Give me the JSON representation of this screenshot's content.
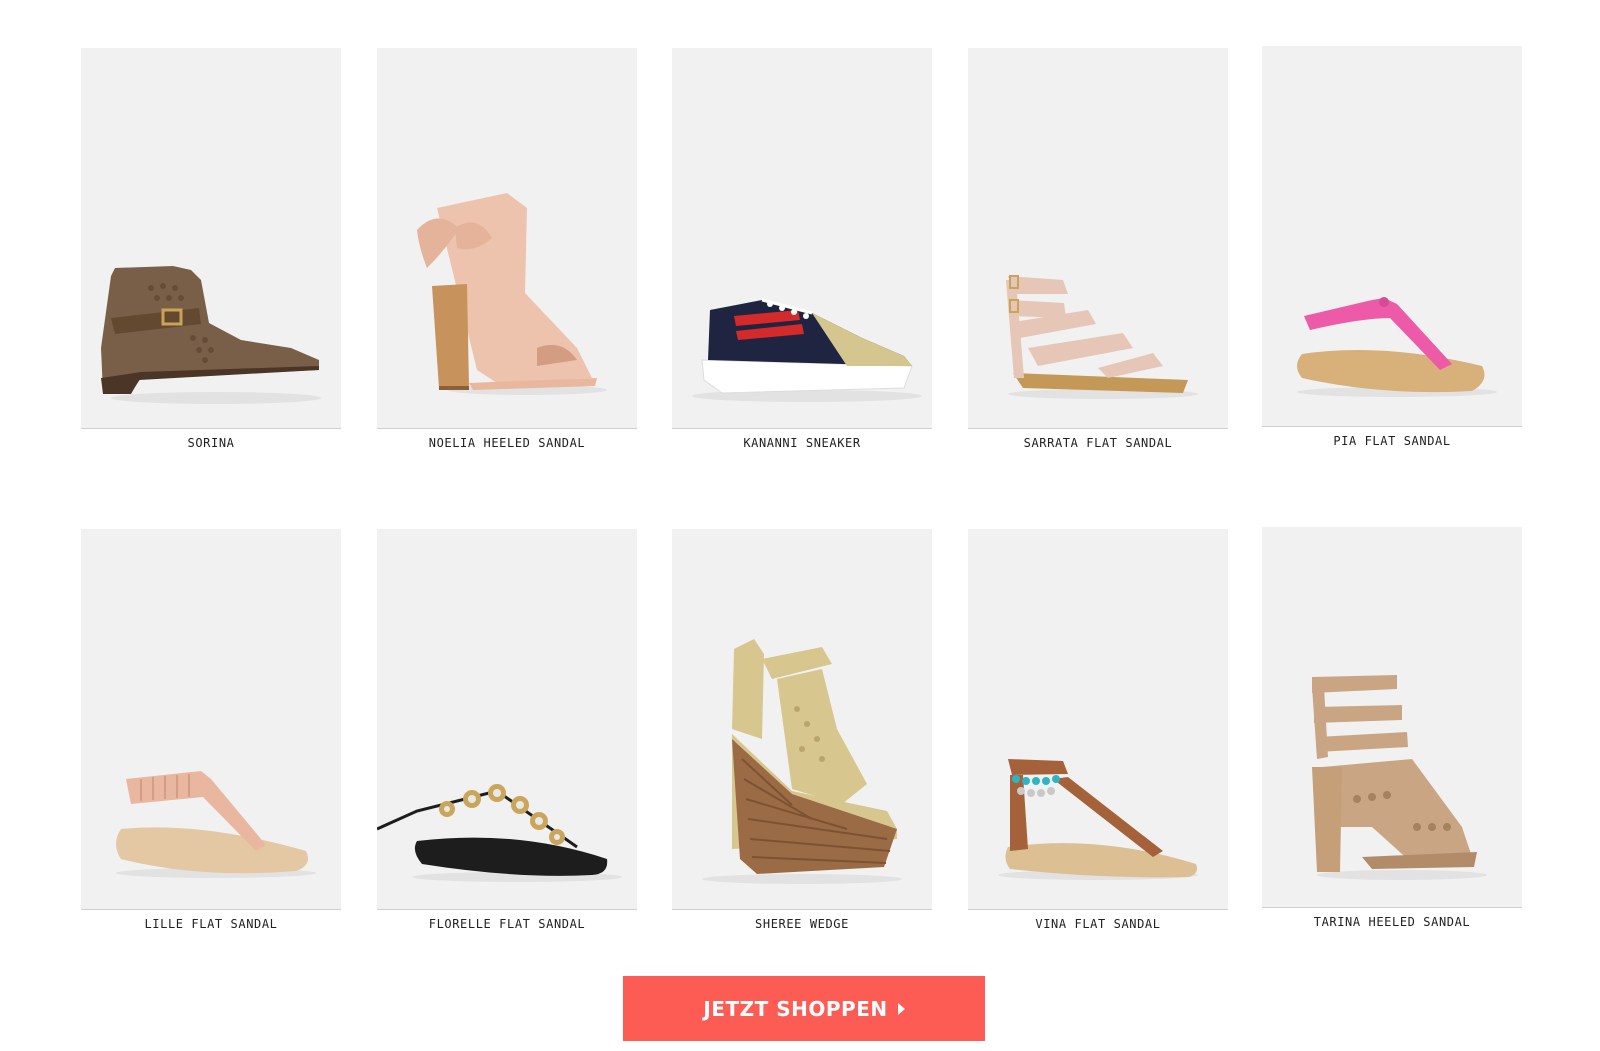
{
  "products": [
    {
      "name": "SORINA",
      "icon": "ankle-boot-icon",
      "color": "#7a5f48"
    },
    {
      "name": "NOELIA HEELED SANDAL",
      "icon": "heeled-sandal-icon",
      "color": "#eec3ad"
    },
    {
      "name": "KANANNI SNEAKER",
      "icon": "sneaker-icon",
      "color": "#1f2540"
    },
    {
      "name": "SARRATA FLAT SANDAL",
      "icon": "strappy-flat-sandal-icon",
      "color": "#e6c6b6"
    },
    {
      "name": "PIA FLAT SANDAL",
      "icon": "thong-sandal-icon",
      "color": "#ec5aa8"
    },
    {
      "name": "LILLE FLAT SANDAL",
      "icon": "thong-sandal-icon",
      "color": "#e9b6a0"
    },
    {
      "name": "FLORELLE FLAT SANDAL",
      "icon": "embellished-sandal-icon",
      "color": "#1d1d1d"
    },
    {
      "name": "SHEREE WEDGE",
      "icon": "wedge-icon",
      "color": "#d8c68f"
    },
    {
      "name": "VINA FLAT SANDAL",
      "icon": "ankle-strap-sandal-icon",
      "color": "#a5623a"
    },
    {
      "name": "TARINA HEELED SANDAL",
      "icon": "strappy-heeled-sandal-icon",
      "color": "#caa584"
    }
  ],
  "cta": {
    "label": "JETZT SHOPPEN",
    "icon": "caret-right-icon",
    "color": "#fc5c54"
  }
}
